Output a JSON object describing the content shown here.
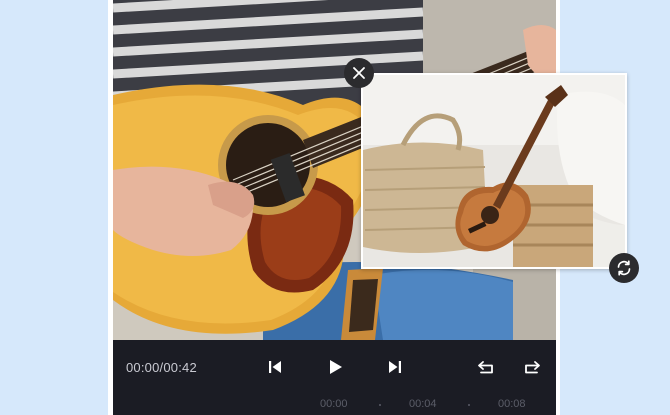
{
  "player": {
    "time_readout": "00:00/00:42"
  },
  "timeline": {
    "ticks": [
      "00:00",
      "00:04",
      "00:08"
    ]
  },
  "icons": {
    "close": "close-icon",
    "rotate": "rotate-icon",
    "prev": "skip-previous-icon",
    "play": "play-icon",
    "next": "skip-next-icon",
    "undo": "undo-icon",
    "redo": "redo-icon"
  },
  "colors": {
    "background": "#d6e8fb",
    "control_bar": "#1b1c24",
    "control_icon": "#ffffff",
    "badge_button": "#2b2b2e"
  }
}
